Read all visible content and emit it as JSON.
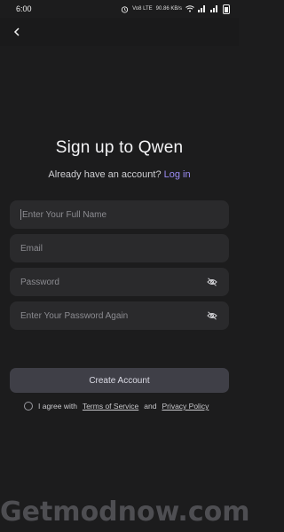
{
  "status": {
    "time": "6:00",
    "net1": "Vo8 LTE",
    "net2": "90.86 KB/s"
  },
  "header": {
    "back_icon": "chevron-left-icon"
  },
  "page": {
    "title": "Sign up to Qwen",
    "subtitle_prefix": "Already have an account?",
    "login_link": "Log in"
  },
  "form": {
    "full_name_placeholder": "Enter Your Full Name",
    "email_placeholder": "Email",
    "password_placeholder": "Password",
    "password_again_placeholder": "Enter Your Password Again",
    "create_button": "Create Account"
  },
  "agreement": {
    "prefix": "I agree with",
    "terms": "Terms of Service",
    "and": "and",
    "privacy": "Privacy Policy"
  },
  "watermark": "Getmodnow.com"
}
